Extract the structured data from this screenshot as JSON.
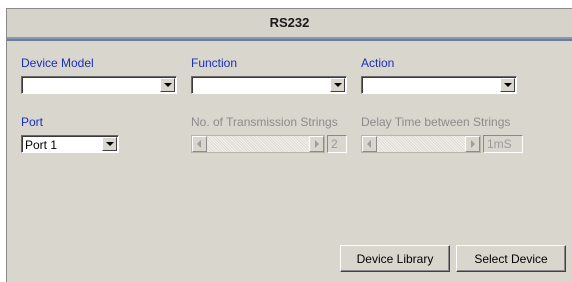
{
  "window": {
    "title": "RS232"
  },
  "device_model": {
    "label": "Device Model",
    "value": ""
  },
  "function": {
    "label": "Function",
    "value": ""
  },
  "action": {
    "label": "Action",
    "value": ""
  },
  "port": {
    "label": "Port",
    "value": "Port 1"
  },
  "transmission": {
    "label": "No. of Transmission Strings",
    "value": "2"
  },
  "delay": {
    "label": "Delay Time between Strings",
    "value": "1mS"
  },
  "buttons": {
    "device_library": "Device Library",
    "select_device": "Select Device"
  }
}
